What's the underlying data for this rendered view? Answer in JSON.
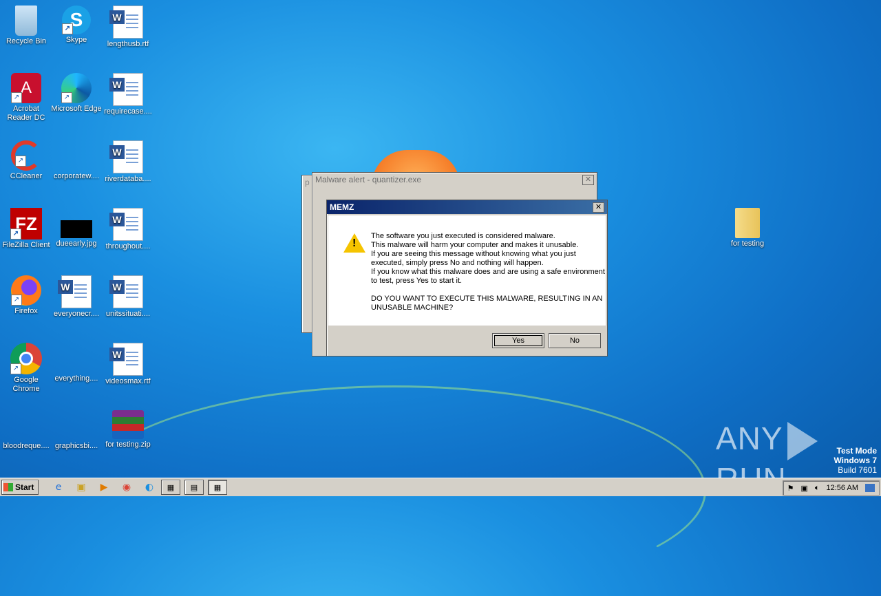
{
  "desktop": {
    "icons": [
      {
        "label": "Recycle Bin",
        "icon": "recycle-bin-icon"
      },
      {
        "label": "Skype",
        "icon": "skype-icon"
      },
      {
        "label": "lengthusb.rtf",
        "icon": "word-doc-icon"
      },
      {
        "label": "Acrobat Reader DC",
        "icon": "acrobat-icon"
      },
      {
        "label": "Microsoft Edge",
        "icon": "edge-icon"
      },
      {
        "label": "requirecase....",
        "icon": "word-doc-icon"
      },
      {
        "label": "CCleaner",
        "icon": "ccleaner-icon"
      },
      {
        "label": "corporatew....",
        "icon": "blank-file-icon"
      },
      {
        "label": "riverdataba....",
        "icon": "word-doc-icon"
      },
      {
        "label": "FileZilla Client",
        "icon": "filezilla-icon"
      },
      {
        "label": "dueearly.jpg",
        "icon": "image-file-icon"
      },
      {
        "label": "throughout....",
        "icon": "word-doc-icon"
      },
      {
        "label": "Firefox",
        "icon": "firefox-icon"
      },
      {
        "label": "everyonecr....",
        "icon": "word-doc-icon"
      },
      {
        "label": "unitssituati....",
        "icon": "word-doc-icon"
      },
      {
        "label": "Google Chrome",
        "icon": "chrome-icon"
      },
      {
        "label": "everything....",
        "icon": "blank-file-icon"
      },
      {
        "label": "videosmax.rtf",
        "icon": "word-doc-icon"
      },
      {
        "label": "bloodreque....",
        "icon": "blank-file-icon"
      },
      {
        "label": "graphicsbi....",
        "icon": "blank-file-icon"
      },
      {
        "label": "for testing.zip",
        "icon": "winrar-icon"
      },
      {
        "label": "for testing",
        "icon": "folder-icon"
      }
    ]
  },
  "back_window": {
    "title": "Malware alert - quantizer.exe",
    "partial_title": "p"
  },
  "memz_dialog": {
    "title": "MEMZ",
    "message": "The software you just executed is considered malware.\nThis malware will harm your computer and makes it unusable.\nIf you are seeing this message without knowing what you just executed, simply press No and nothing will happen.\nIf you know what this malware does and are using a safe environment to test, press Yes to start it.\n\nDO YOU WANT TO EXECUTE THIS MALWARE, RESULTING IN AN UNUSABLE MACHINE?",
    "yes_label": "Yes",
    "no_label": "No"
  },
  "watermark": {
    "text_left": "ANY",
    "text_right": "RUN"
  },
  "test_mode": {
    "line1": "Test Mode",
    "line2": "Windows 7",
    "line3": "Build 7601"
  },
  "taskbar": {
    "start_label": "Start",
    "clock": "12:56 AM"
  },
  "colors": {
    "accent": "#0a246a",
    "warning": "#f5c400",
    "desktop": "#1a8fe0"
  }
}
